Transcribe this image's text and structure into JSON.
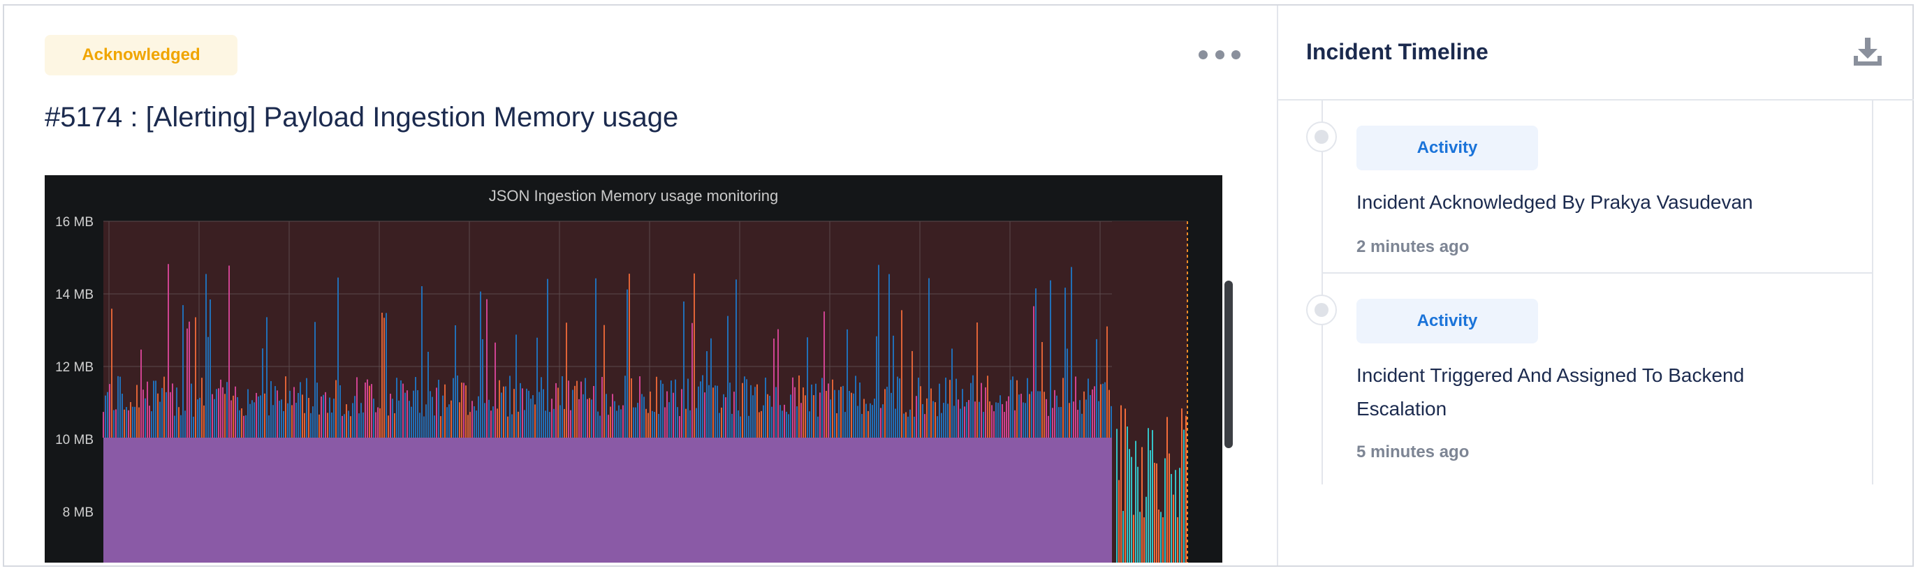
{
  "incident": {
    "status_badge": "Acknowledged",
    "title": "#5174 : [Alerting] Payload Ingestion Memory usage",
    "more_icon": "more-horizontal-icon"
  },
  "graph": {
    "title": "JSON Ingestion Memory usage monitoring",
    "y_ticks": [
      "16 MB",
      "14 MB",
      "12 MB",
      "10 MB",
      "8 MB"
    ]
  },
  "timeline": {
    "title": "Incident Timeline",
    "download_icon": "download-icon",
    "items": [
      {
        "tag": "Activity",
        "message": "Incident Acknowledged By Prakya Vasudevan",
        "time": "2 minutes ago"
      },
      {
        "tag": "Activity",
        "message": "Incident Triggered And Assigned To Backend Escalation",
        "time": "5 minutes ago"
      }
    ]
  },
  "colors": {
    "badge_text": "#f0a500",
    "badge_bg": "#fdf6e3",
    "activity_text": "#1a73d9",
    "activity_bg": "#eef4fd",
    "graph_purple": "#8a5aa6",
    "graph_blue": "#1f78c8",
    "graph_pink": "#e0479e",
    "graph_orange": "#f26b3a",
    "graph_cyan": "#34c3c7"
  }
}
